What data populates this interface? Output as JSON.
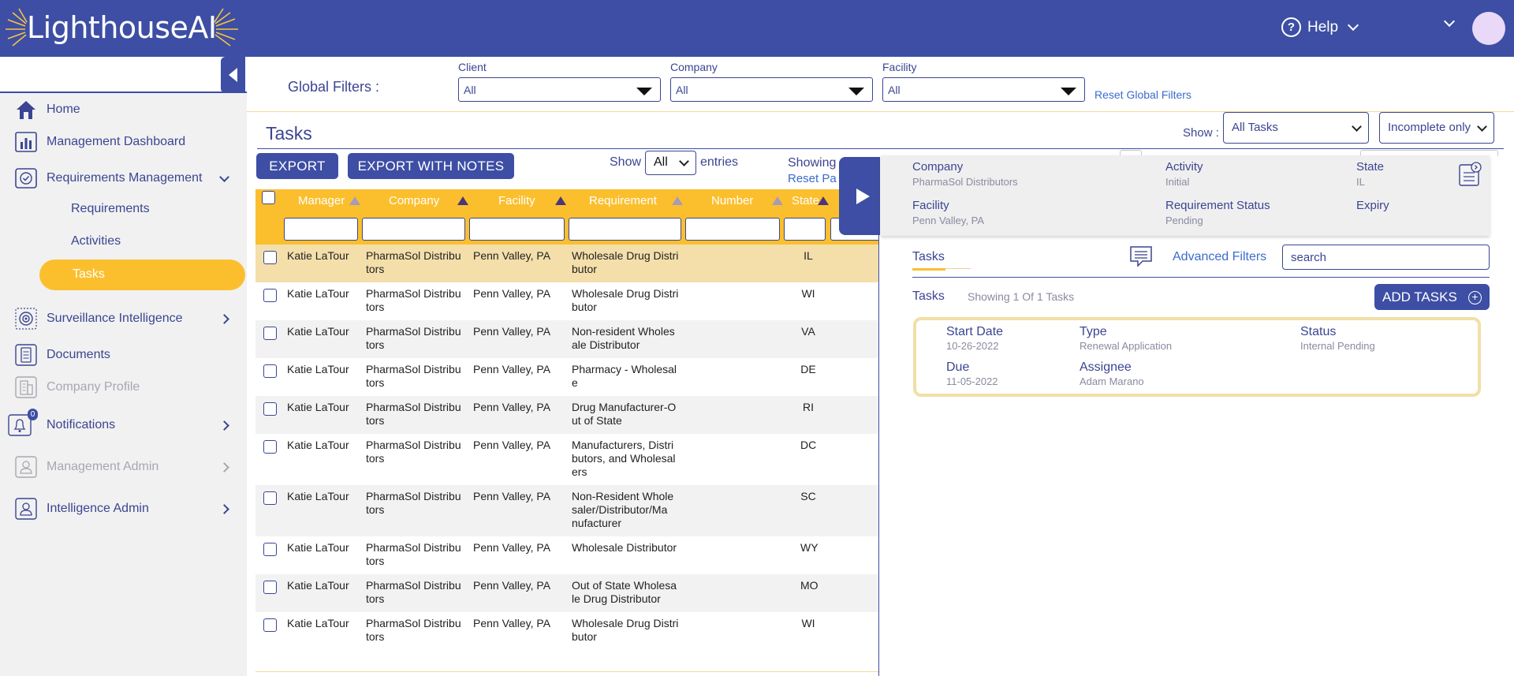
{
  "app": {
    "logo_text": "LighthouseAI",
    "help_label": "Help"
  },
  "colors": {
    "primary": "#3d4ea4",
    "accent": "#fbbf2e",
    "link": "#3b6ccb",
    "selected_row": "#f4dfaa"
  },
  "sidebar": {
    "items": [
      {
        "label": "Home",
        "icon": "home-icon"
      },
      {
        "label": "Management Dashboard",
        "icon": "bar-chart-icon"
      },
      {
        "label": "Requirements Management",
        "icon": "check-circle-icon"
      },
      {
        "label": "Requirements"
      },
      {
        "label": "Activities"
      },
      {
        "label": "Tasks"
      },
      {
        "label": "Surveillance Intelligence",
        "icon": "radar-icon"
      },
      {
        "label": "Documents",
        "icon": "document-icon"
      },
      {
        "label": "Company Profile",
        "icon": "building-icon"
      },
      {
        "label": "Notifications",
        "icon": "bell-icon",
        "badge": "0"
      },
      {
        "label": "Management Admin",
        "icon": "user-icon"
      },
      {
        "label": "Intelligence Admin",
        "icon": "user-icon"
      }
    ]
  },
  "global_filters": {
    "label": "Global Filters :",
    "client": {
      "label": "Client",
      "value": "All"
    },
    "company": {
      "label": "Company",
      "value": "All"
    },
    "facility": {
      "label": "Facility",
      "value": "All"
    },
    "reset": "Reset Global Filters"
  },
  "tasks": {
    "title": "Tasks",
    "show_label": "Show :",
    "show_type": "All Tasks",
    "show_status": "Incomplete only",
    "export": "EXPORT",
    "export_notes": "EXPORT WITH NOTES",
    "entries_show": "Show",
    "entries_value": "All",
    "entries_label": "entries",
    "showing": "Showing",
    "reset_page": "Reset Pa"
  },
  "table": {
    "columns": [
      "Manager",
      "Company",
      "Facility",
      "Requirement",
      "Number",
      "State"
    ],
    "rows": [
      {
        "manager": "Katie LaTour",
        "company": [
          "PharmaSol Distribu",
          "tors"
        ],
        "facility": "Penn Valley, PA",
        "requirement": [
          "Wholesale Drug Distri",
          "butor"
        ],
        "number": "",
        "state": "IL"
      },
      {
        "manager": "Katie LaTour",
        "company": [
          "PharmaSol Distribu",
          "tors"
        ],
        "facility": "Penn Valley, PA",
        "requirement": [
          "Wholesale Drug Distri",
          "butor"
        ],
        "number": "",
        "state": "WI"
      },
      {
        "manager": "Katie LaTour",
        "company": [
          "PharmaSol Distribu",
          "tors"
        ],
        "facility": "Penn Valley, PA",
        "requirement": [
          "Non-resident Wholes",
          "ale Distributor"
        ],
        "number": "",
        "state": "VA"
      },
      {
        "manager": "Katie LaTour",
        "company": [
          "PharmaSol Distribu",
          "tors"
        ],
        "facility": "Penn Valley, PA",
        "requirement": [
          "Pharmacy - Wholesal",
          "e"
        ],
        "number": "",
        "state": "DE"
      },
      {
        "manager": "Katie LaTour",
        "company": [
          "PharmaSol Distribu",
          "tors"
        ],
        "facility": "Penn Valley, PA",
        "requirement": [
          "Drug Manufacturer-O",
          "ut of State"
        ],
        "number": "",
        "state": "RI"
      },
      {
        "manager": "Katie LaTour",
        "company": [
          "PharmaSol Distribu",
          "tors"
        ],
        "facility": "Penn Valley, PA",
        "requirement": [
          "Manufacturers, Distri",
          "butors, and Wholesal",
          "ers"
        ],
        "number": "",
        "state": "DC"
      },
      {
        "manager": "Katie LaTour",
        "company": [
          "PharmaSol Distribu",
          "tors"
        ],
        "facility": "Penn Valley, PA",
        "requirement": [
          "Non-Resident Whole",
          "saler/Distributor/Ma",
          "nufacturer"
        ],
        "number": "",
        "state": "SC"
      },
      {
        "manager": "Katie LaTour",
        "company": [
          "PharmaSol Distribu",
          "tors"
        ],
        "facility": "Penn Valley, PA",
        "requirement": [
          "Wholesale Distributor"
        ],
        "number": "",
        "state": "WY"
      },
      {
        "manager": "Katie LaTour",
        "company": [
          "PharmaSol Distribu",
          "tors"
        ],
        "facility": "Penn Valley, PA",
        "requirement": [
          "Out of State Wholesa",
          "le Drug Distributor"
        ],
        "number": "",
        "state": "MO"
      },
      {
        "manager": "Katie LaTour",
        "company": [
          "PharmaSol Distribu",
          "tors"
        ],
        "facility": "Penn Valley, PA",
        "requirement": [
          "Wholesale Drug Distri",
          "butor"
        ],
        "number": "",
        "state": "WI"
      }
    ]
  },
  "detail": {
    "company_label": "Company",
    "company": "PharmaSol Distributors",
    "activity_label": "Activity",
    "activity": "Initial",
    "state_label": "State",
    "state": "IL",
    "facility_label": "Facility",
    "facility": "Penn Valley, PA",
    "req_status_label": "Requirement Status",
    "req_status": "Pending",
    "expiry_label": "Expiry"
  },
  "right_panel": {
    "tab": "Tasks",
    "advanced_filters": "Advanced Filters",
    "search_value": "search",
    "tasks_label": "Tasks",
    "showing": "Showing 1 Of 1 Tasks",
    "add_tasks": "ADD TASKS",
    "task": {
      "start_label": "Start Date",
      "start": "10-26-2022",
      "type_label": "Type",
      "type": "Renewal Application",
      "status_label": "Status",
      "status": "Internal Pending",
      "due_label": "Due",
      "due": "11-05-2022",
      "assignee_label": "Assignee",
      "assignee": "Adam Marano"
    }
  }
}
